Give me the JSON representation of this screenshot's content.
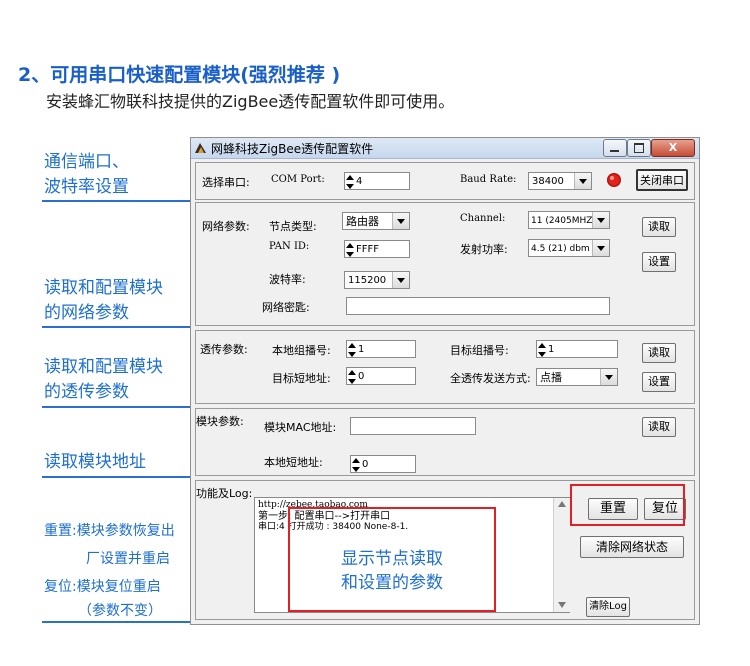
{
  "heading": "2、可用串口快速配置模块(强烈推荐 )",
  "subheading": "安装蜂汇物联科技提供的ZigBee透传配置软件即可使用。",
  "side_labels": {
    "serial": [
      "通信端口、",
      "波特率设置"
    ],
    "network": [
      "读取和配置模块",
      "的网络参数"
    ],
    "transparent": [
      "读取和配置模块",
      "的透传参数"
    ],
    "address": "读取模块地址",
    "reset_line1": "重置:模块参数恢复出",
    "reset_line2": "厂设置并重启",
    "restart_line1": "复位:模块复位重启",
    "restart_line2": "（参数不变）"
  },
  "window": {
    "title": "网蜂科技ZigBee透传配置软件",
    "close_glyph": "X"
  },
  "serial": {
    "select_label": "选择串口:",
    "com_label": "COM Port:",
    "com_value": "4",
    "baud_label": "Baud Rate:",
    "baud_value": "38400",
    "close_button": "关闭串口",
    "led_color": "#e3231b"
  },
  "network": {
    "section_label": "网络参数:",
    "node_type_label": "节点类型:",
    "node_type_value": "路由器",
    "channel_label": "Channel:",
    "channel_value": "11 (2405MHZ)",
    "pan_label": "PAN ID:",
    "pan_value": "FFFF",
    "power_label": "发射功率:",
    "power_value": "4.5 (21) dbm",
    "baud_label": "波特率:",
    "baud_value": "115200",
    "key_label": "网络密匙:",
    "key_value": "",
    "read_button": "读取",
    "set_button": "设置"
  },
  "transparent": {
    "section_label": "透传参数:",
    "group_label": "本地组播号:",
    "group_value": "1",
    "target_group_label": "目标组播号:",
    "target_group_value": "1",
    "short_addr_label": "目标短地址:",
    "short_addr_value": "0",
    "mode_label": "全透传发送方式:",
    "mode_value": "点播",
    "read_button": "读取",
    "set_button": "设置"
  },
  "module": {
    "section_label": "模块参数:",
    "mac_label": "模块MAC地址:",
    "mac_value": "",
    "short_label": "本地短地址:",
    "short_value": "0",
    "read_button": "读取"
  },
  "log": {
    "section_label": "功能及Log:",
    "line1": "http://zebee.taobao.com",
    "line2": "第一步: 配置串口-->打开串口",
    "line3": "串口:4 打开成功 : 38400 None-8-1.",
    "annotation_line1": "显示节点读取",
    "annotation_line2": "和设置的参数",
    "reset_button": "重置",
    "restart_button": "复位",
    "clear_network_button": "清除网络状态",
    "clear_log_button": "清除Log"
  },
  "colors": {
    "heading": "#1a5fc8",
    "side_label": "#1e6fd0",
    "rule": "#2b6fd1",
    "highlight": "#e01f26"
  }
}
